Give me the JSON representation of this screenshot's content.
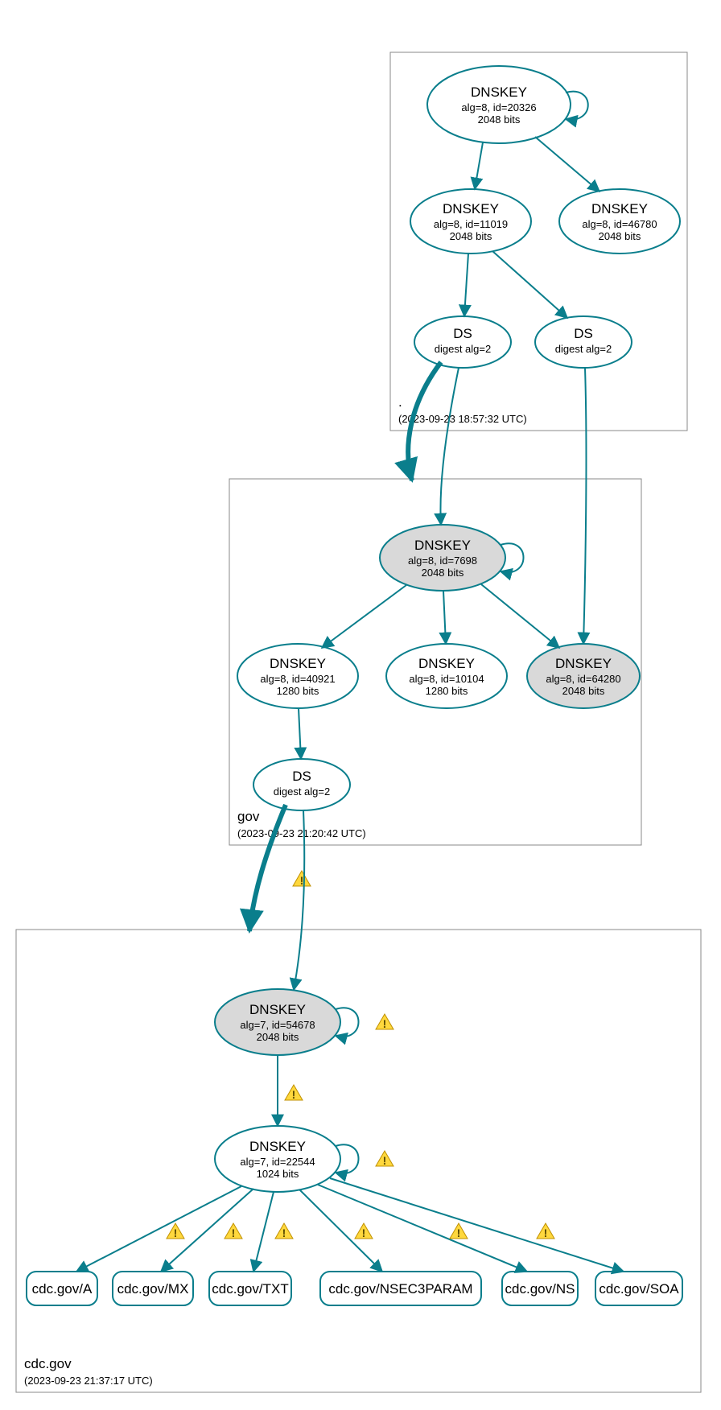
{
  "zones": {
    "root": {
      "label": ".",
      "timestamp": "(2023-09-23 18:57:32 UTC)"
    },
    "gov": {
      "label": "gov",
      "timestamp": "(2023-09-23 21:20:42 UTC)"
    },
    "cdc": {
      "label": "cdc.gov",
      "timestamp": "(2023-09-23 21:37:17 UTC)"
    }
  },
  "nodes": {
    "root_ksk": {
      "title": "DNSKEY",
      "line2": "alg=8, id=20326",
      "line3": "2048 bits"
    },
    "root_zsk1": {
      "title": "DNSKEY",
      "line2": "alg=8, id=11019",
      "line3": "2048 bits"
    },
    "root_zsk2": {
      "title": "DNSKEY",
      "line2": "alg=8, id=46780",
      "line3": "2048 bits"
    },
    "root_ds1": {
      "title": "DS",
      "line2": "digest alg=2"
    },
    "root_ds2": {
      "title": "DS",
      "line2": "digest alg=2"
    },
    "gov_ksk": {
      "title": "DNSKEY",
      "line2": "alg=8, id=7698",
      "line3": "2048 bits"
    },
    "gov_zsk1": {
      "title": "DNSKEY",
      "line2": "alg=8, id=40921",
      "line3": "1280 bits"
    },
    "gov_zsk2": {
      "title": "DNSKEY",
      "line2": "alg=8, id=10104",
      "line3": "1280 bits"
    },
    "gov_zsk3": {
      "title": "DNSKEY",
      "line2": "alg=8, id=64280",
      "line3": "2048 bits"
    },
    "gov_ds": {
      "title": "DS",
      "line2": "digest alg=2"
    },
    "cdc_ksk": {
      "title": "DNSKEY",
      "line2": "alg=7, id=54678",
      "line3": "2048 bits"
    },
    "cdc_zsk": {
      "title": "DNSKEY",
      "line2": "alg=7, id=22544",
      "line3": "1024 bits"
    }
  },
  "leaves": {
    "a": "cdc.gov/A",
    "mx": "cdc.gov/MX",
    "txt": "cdc.gov/TXT",
    "nsec": "cdc.gov/NSEC3PARAM",
    "ns": "cdc.gov/NS",
    "soa": "cdc.gov/SOA"
  },
  "colors": {
    "edge": "#0a7e8c",
    "shaded": "#d9d9d9",
    "warn": "#ffd83d"
  }
}
